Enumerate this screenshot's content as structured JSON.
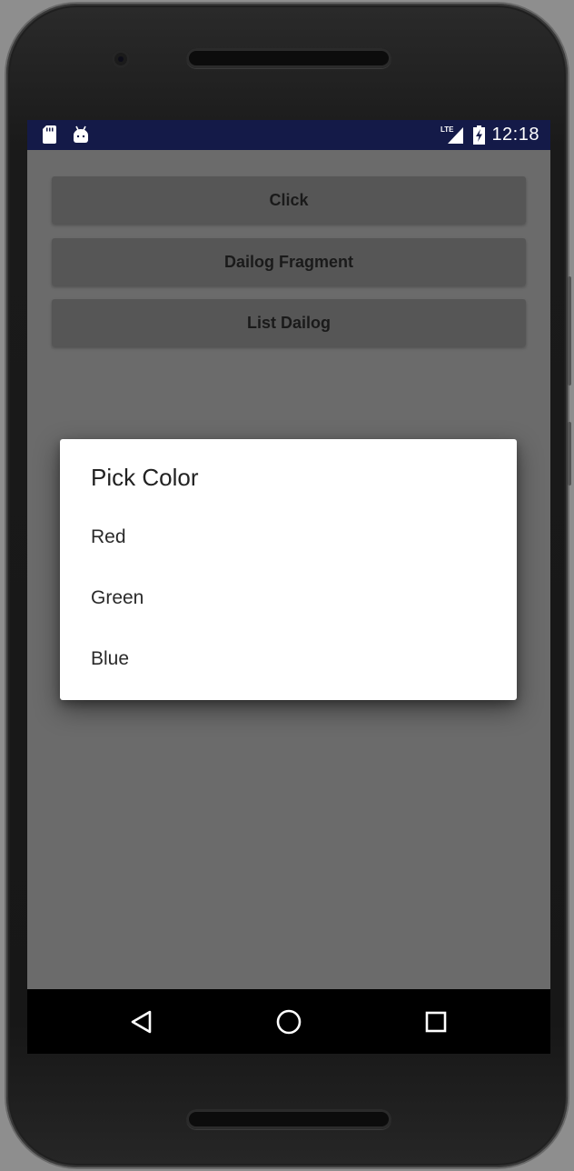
{
  "status_bar": {
    "time": "12:18",
    "network": "LTE",
    "icons": [
      "sd-card-icon",
      "android-icon",
      "lte-signal-icon",
      "battery-charging-icon"
    ]
  },
  "buttons": [
    {
      "label": "Click"
    },
    {
      "label": "Dailog Fragment"
    },
    {
      "label": "List Dailog"
    }
  ],
  "dialog": {
    "title": "Pick Color",
    "items": [
      "Red",
      "Green",
      "Blue"
    ]
  },
  "nav_bar": {
    "icons": [
      "back-icon",
      "home-icon",
      "recents-icon"
    ]
  },
  "colors": {
    "status_bar": "#141a48",
    "scrim_background": "#6b6b6b",
    "button_background": "#565656",
    "dialog_background": "#ffffff",
    "nav_bar": "#000000"
  }
}
